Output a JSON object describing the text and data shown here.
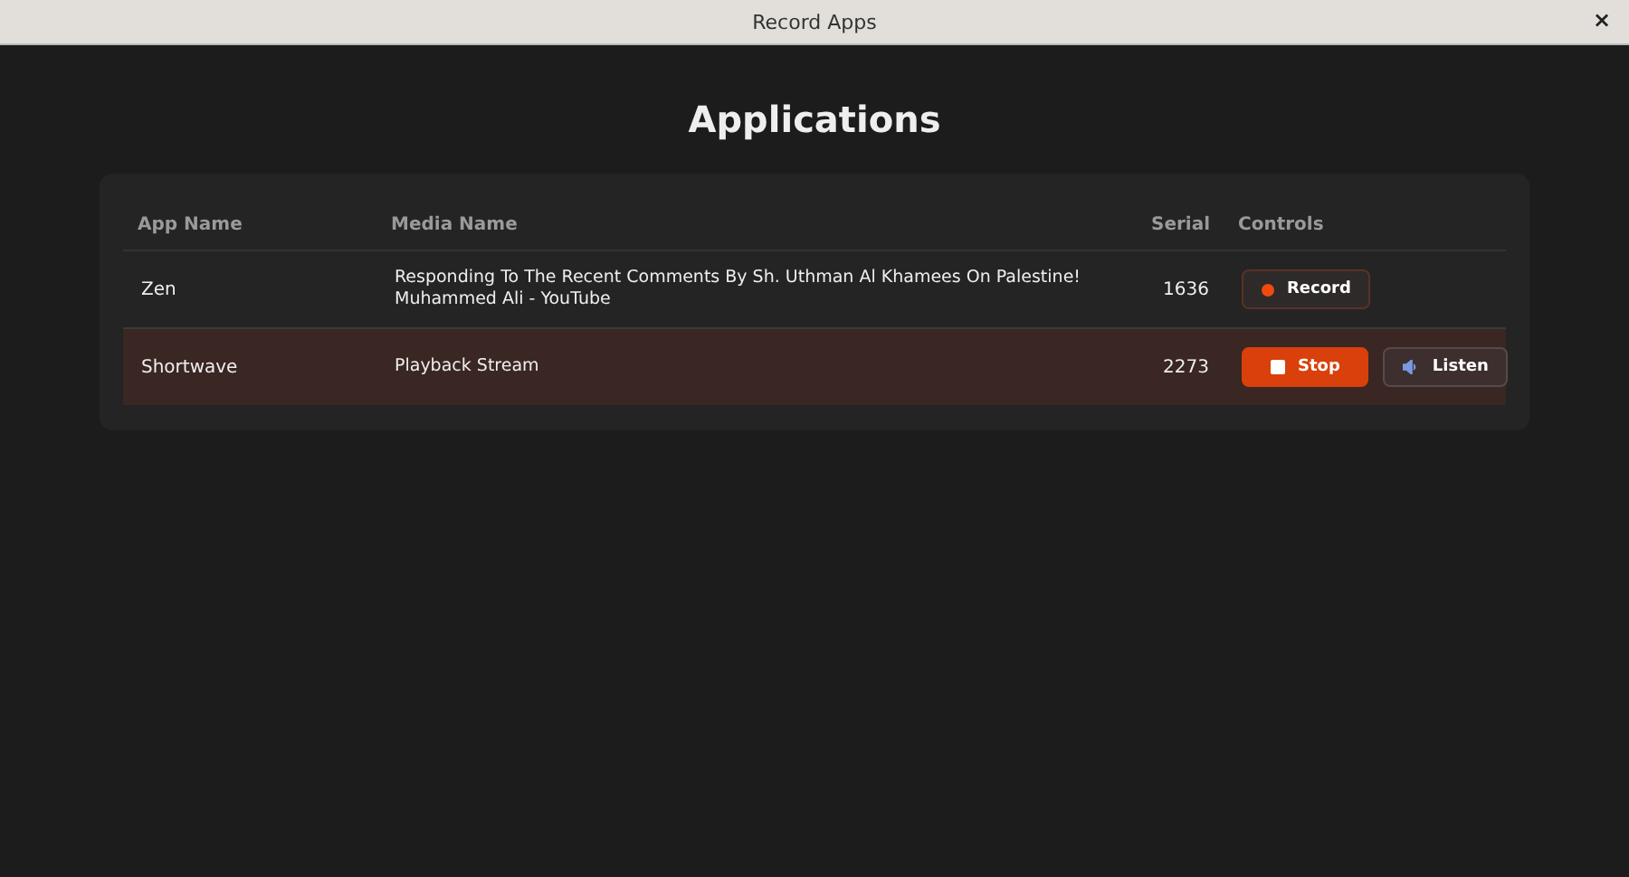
{
  "window": {
    "title": "Record Apps",
    "close": "×"
  },
  "heading": "Applications",
  "table": {
    "columns": [
      "App Name",
      "Media Name",
      "Serial",
      "Controls"
    ],
    "rows": [
      {
        "app": "Zen",
        "media": "Responding To The Recent Comments By Sh. Uthman Al Khamees On Palestine! Muhammed Ali - YouTube",
        "serial": "1636",
        "recording": false,
        "record_label": "Record"
      },
      {
        "app": "Shortwave",
        "media": "Playback Stream",
        "serial": "2273",
        "recording": true,
        "stop_label": "Stop",
        "listen_label": "Listen"
      }
    ]
  }
}
